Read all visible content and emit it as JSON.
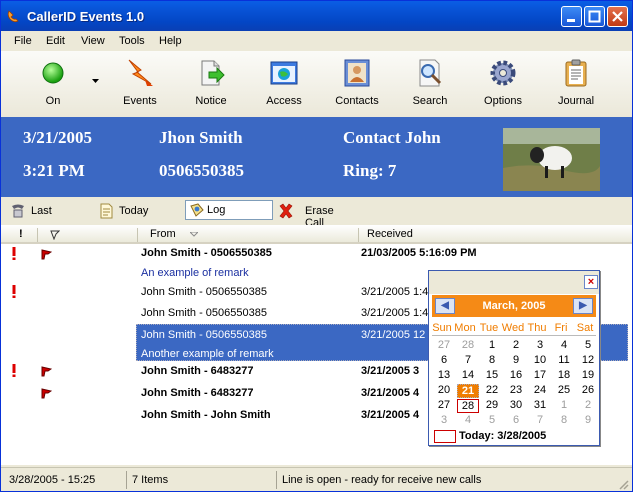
{
  "window": {
    "title": "CallerID Events 1.0"
  },
  "menu": [
    "File",
    "Edit",
    "View",
    "Tools",
    "Help"
  ],
  "toolbar": [
    {
      "label": "On",
      "icon": "green-circle-icon"
    },
    {
      "label": "Events",
      "icon": "lightning-events-icon"
    },
    {
      "label": "Notice",
      "icon": "notice-page-icon"
    },
    {
      "label": "Access",
      "icon": "access-browser-icon"
    },
    {
      "label": "Contacts",
      "icon": "contact-person-icon"
    },
    {
      "label": "Search",
      "icon": "magnifier-search-icon"
    },
    {
      "label": "Options",
      "icon": "gear-icon"
    },
    {
      "label": "Journal",
      "icon": "clipboard-journal-icon"
    }
  ],
  "banner": {
    "date": "3/21/2005",
    "time": "3:21 PM",
    "name": "Jhon Smith",
    "number": "0506550385",
    "contact": "Contact John",
    "ring": "Ring: 7"
  },
  "actions": {
    "last": "Last",
    "today": "Today",
    "log": "Log",
    "erase": "Erase Call"
  },
  "columns": {
    "excl": "!",
    "flag": "",
    "from": "From",
    "received": "Received"
  },
  "rows": [
    {
      "from": "John Smith - 0506550385",
      "received": "21/03/2005 5:16:09 PM"
    },
    {
      "from": "John Smith - 0506550385",
      "received": "3/21/2005 1:4"
    },
    {
      "from": "John Smith - 0506550385",
      "received": "3/21/2005 1:4"
    },
    {
      "from": "John Smith - 0506550385",
      "received": "3/21/2005 12"
    },
    {
      "from": "John Smith - 6483277",
      "received": "3/21/2005 3"
    },
    {
      "from": "John Smith - 6483277",
      "received": "3/21/2005 4"
    },
    {
      "from": "John Smith - John Smith",
      "received": "3/21/2005 4"
    }
  ],
  "remarks": {
    "first": "An example of remark",
    "second": "Another example of remark"
  },
  "calendar": {
    "month": "March, 2005",
    "weekdays": [
      "Sun",
      "Mon",
      "Tue",
      "Wed",
      "Thu",
      "Fri",
      "Sat"
    ],
    "weeks": [
      [
        "27",
        "28",
        "1",
        "2",
        "3",
        "4",
        "5"
      ],
      [
        "6",
        "7",
        "8",
        "9",
        "10",
        "11",
        "12"
      ],
      [
        "13",
        "14",
        "15",
        "16",
        "17",
        "18",
        "19"
      ],
      [
        "20",
        "21",
        "22",
        "23",
        "24",
        "25",
        "26"
      ],
      [
        "27",
        "28",
        "29",
        "30",
        "31",
        "1",
        "2"
      ],
      [
        "3",
        "4",
        "5",
        "6",
        "7",
        "8",
        "9"
      ]
    ],
    "today": "Today: 3/28/2005",
    "close": "×",
    "prev": "◀",
    "next": "▶"
  },
  "status": {
    "datetime": "3/28/2005 - 15:25",
    "items": "7 Items",
    "line": "Line is open - ready for receive new calls"
  },
  "colors": {
    "banner": "#3b68c3",
    "title": "#0a5ee5",
    "calendar_header": "#f58a16"
  }
}
